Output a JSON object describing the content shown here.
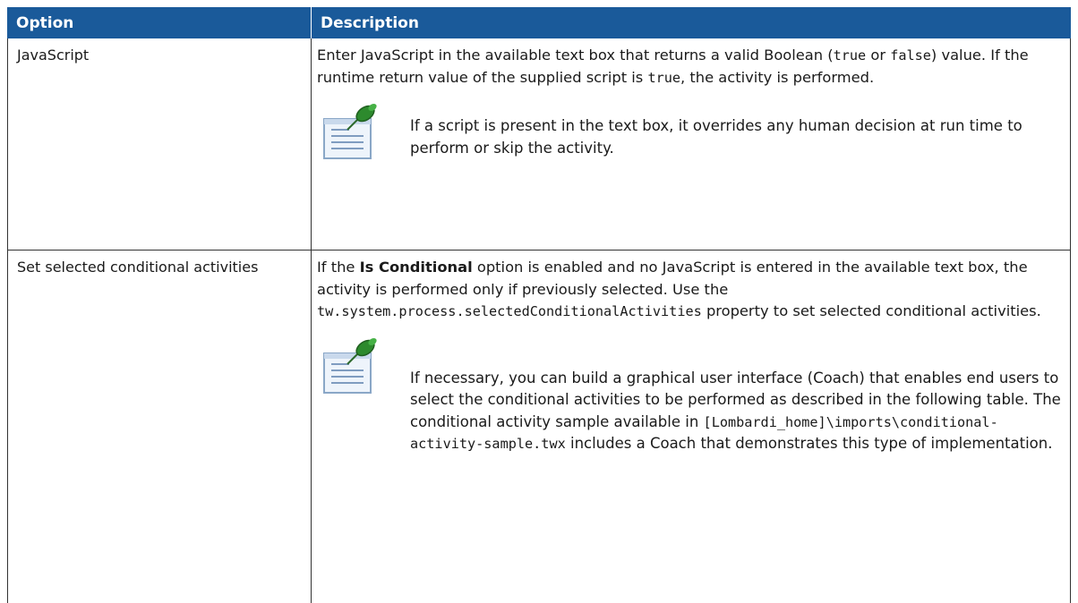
{
  "table": {
    "headers": {
      "option": "Option",
      "description": "Description"
    },
    "rows": [
      {
        "option": "JavaScript",
        "desc_a": "Enter JavaScript in the available text box that returns a valid Boolean (",
        "desc_b": "true",
        "desc_c": " or ",
        "desc_d": "false",
        "desc_e": ") value. If the runtime return value of the supplied script is ",
        "desc_f": "true",
        "desc_g": ", the activity is performed.",
        "note": "If a script is present in the text box, it overrides any human decision at run time to perform or skip the activity."
      },
      {
        "option": "Set selected conditional activities",
        "desc_a": "If the ",
        "desc_bold": "Is Conditional",
        "desc_b": " option is enabled and no JavaScript is entered in the available text box, the activity is performed only if previously selected. Use the ",
        "desc_code": "tw.system.process.selectedConditionalActivities",
        "desc_c": " property to set selected conditional activities.",
        "note_a": "If necessary, you can build a graphical user interface (Coach) that enables end users to select the conditional activities to be performed as described in the following table. The conditional activity sample available in ",
        "note_code": "[Lombardi_home]\\imports\\conditional-activity-sample.twx",
        "note_b": " includes a Coach that demonstrates this type of implementation."
      }
    ]
  },
  "icons": {
    "note": "note-pushpin-icon"
  },
  "colors": {
    "header_bg": "#1a5a9a",
    "header_text": "#ffffff",
    "border": "#333333",
    "pin": "#2d8a2d"
  }
}
